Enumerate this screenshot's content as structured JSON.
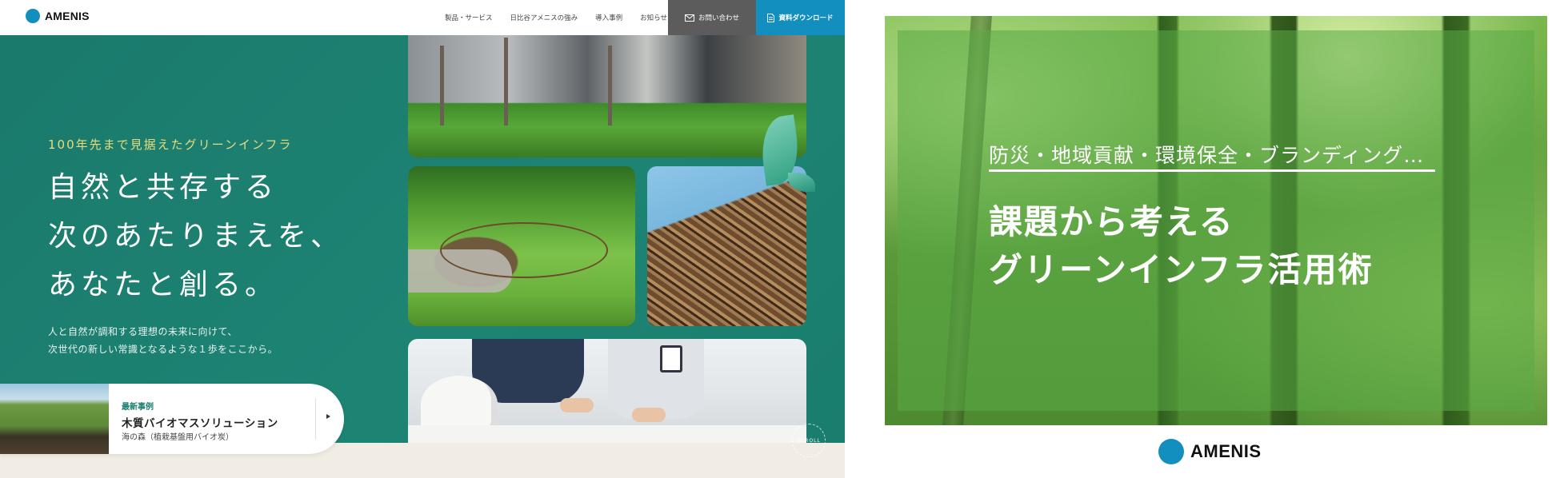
{
  "site": {
    "logo_text": "AMENIS",
    "nav": [
      "製品・サービス",
      "日比谷アメニスの強み",
      "導入事例",
      "お知らせ"
    ],
    "contact_label": "お問い合わせ",
    "download_label": "資料ダウンロード",
    "hero": {
      "eyebrow": "100年先まで見据えたグリーンインフラ",
      "headline": [
        "自然と共存する",
        "次のあたりまえを、",
        "あなたと創る。"
      ],
      "lead": [
        "人と自然が調和する理想の未来に向けて、",
        "次世代の新しい常識となるような１歩をここから。"
      ]
    },
    "latest": {
      "tag": "最新事例",
      "title": "木質バイオマスソリューション",
      "subtitle": "海の森（植栽基盤用バイオ炭）"
    },
    "scroll_label": "SCROLL",
    "colors": {
      "primary": "#1b7d6e",
      "accent": "#138fbf",
      "eyebrow": "#e8dc7c"
    }
  },
  "banner": {
    "kicker": "防災・地域貢献・環境保全・ブランディング…",
    "title": [
      "課題から考える",
      "グリーンインフラ活用術"
    ],
    "logo_text": "AMENIS"
  }
}
